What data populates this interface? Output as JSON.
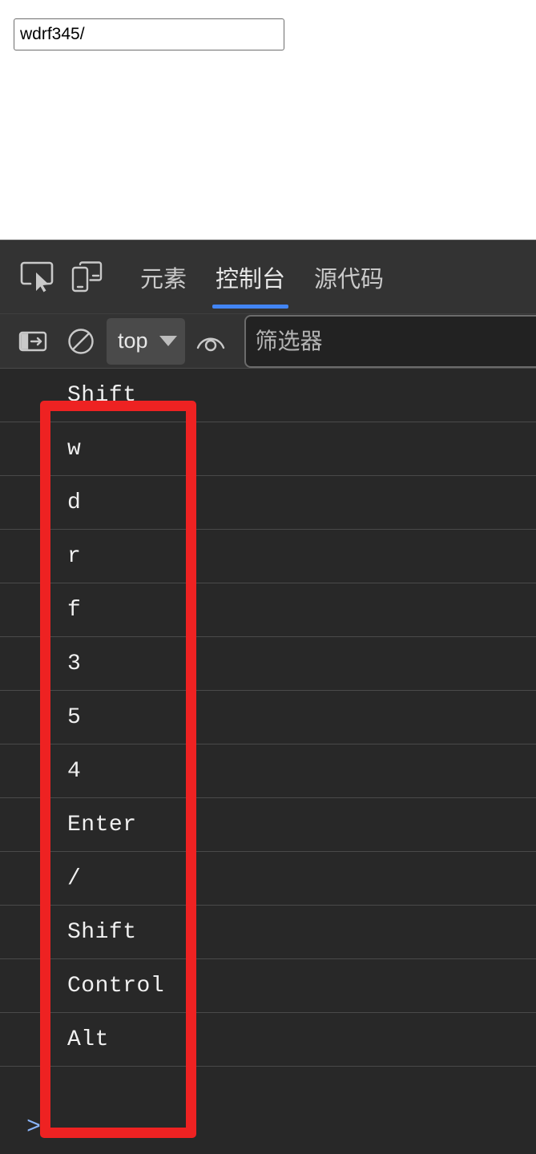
{
  "page": {
    "input": {
      "value": "wdrf345/",
      "placeholder": ""
    }
  },
  "devtools": {
    "toolbar_icons": [
      {
        "name": "inspect-element-icon",
        "label": "检查元素"
      },
      {
        "name": "device-toolbar-icon",
        "label": "设备工具栏"
      }
    ],
    "tabs": [
      {
        "label": "元素",
        "name": "tab-elements",
        "active": false
      },
      {
        "label": "控制台",
        "name": "tab-console",
        "active": true
      },
      {
        "label": "源代码",
        "name": "tab-sources",
        "active": false
      }
    ],
    "active_tab": "控制台",
    "accent_color": "#4285f4",
    "console_toolbar": {
      "sidebar_toggle": {
        "name": "console-sidebar-icon",
        "label": "控制台边栏"
      },
      "clear_console": {
        "name": "clear-console-icon",
        "label": "清除控制台"
      },
      "context": {
        "label": "top",
        "caret": "chevron-down-icon"
      },
      "live_expression": {
        "name": "eye-icon",
        "label": "创建实时表达式"
      },
      "filter": {
        "value": "",
        "placeholder": "筛选器"
      }
    },
    "console_messages": [
      "Shift",
      "w",
      "d",
      "r",
      "f",
      "3",
      "5",
      "4",
      "Enter",
      "/",
      "Shift",
      "Control",
      "Alt"
    ],
    "prompt_symbol": ">",
    "annotation": {
      "name": "red-highlight-box",
      "color": "#ee2222"
    }
  }
}
